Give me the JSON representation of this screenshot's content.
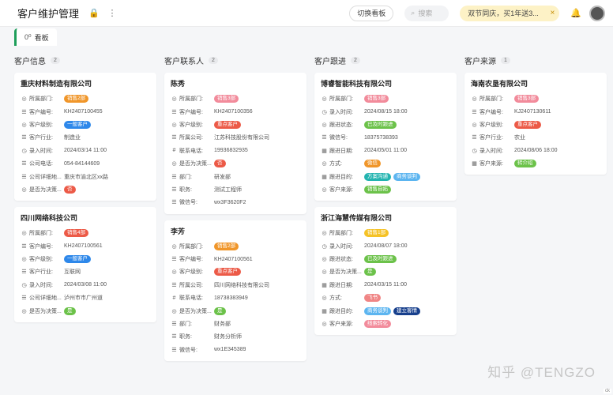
{
  "header": {
    "title": "客户维护管理",
    "switch_label": "切换看板",
    "search_placeholder": "搜索",
    "promo_text": "双节同庆，买1年送3...",
    "close_glyph": "×",
    "lock_glyph": "🔒",
    "more_glyph": "⋮",
    "bell_glyph": "🔔"
  },
  "tabs": [
    {
      "label": "看板",
      "prefix": "0⁰"
    }
  ],
  "colors": {
    "orange": "#f0962a",
    "blue": "#2e88ea",
    "red": "#ec5a47",
    "pink": "#f28b9b",
    "green": "#6cc24a",
    "yellow": "#f5c226",
    "teal": "#23b4b0",
    "navy": "#173f8c",
    "cyan": "#5cb5f0",
    "rose": "#f08585"
  },
  "columns": [
    {
      "title": "客户信息",
      "count": "2",
      "cards": [
        {
          "title": "重庆材料制造有限公司",
          "fields": [
            {
              "icon": "◎",
              "label": "所属部门:",
              "tags": [
                {
                  "text": "销售2部",
                  "color": "#f0962a"
                }
              ]
            },
            {
              "icon": "☰",
              "label": "客户编号:",
              "value": "KH2407100455"
            },
            {
              "icon": "◎",
              "label": "客户级别:",
              "tags": [
                {
                  "text": "一般客户",
                  "color": "#2e88ea"
                }
              ]
            },
            {
              "icon": "☰",
              "label": "客户行业:",
              "value": "制造业"
            },
            {
              "icon": "◷",
              "label": "录入时间:",
              "value": "2024/03/14 11:00"
            },
            {
              "icon": "☰",
              "label": "公司电话:",
              "value": "054-84144609"
            },
            {
              "icon": "☰",
              "label": "公司详细地...",
              "value": "重庆市渝北区xx路"
            },
            {
              "icon": "◎",
              "label": "是否为决策...",
              "tags": [
                {
                  "text": "否",
                  "color": "#ec5a47"
                }
              ]
            }
          ]
        },
        {
          "title": "四川网络科技公司",
          "fields": [
            {
              "icon": "◎",
              "label": "所属部门:",
              "tags": [
                {
                  "text": "销售4部",
                  "color": "#ec5a47"
                }
              ]
            },
            {
              "icon": "☰",
              "label": "客户编号:",
              "value": "KH2407100561"
            },
            {
              "icon": "◎",
              "label": "客户级别:",
              "tags": [
                {
                  "text": "一般客户",
                  "color": "#2e88ea"
                }
              ]
            },
            {
              "icon": "☰",
              "label": "客户行业:",
              "value": "互联网"
            },
            {
              "icon": "◷",
              "label": "录入时间:",
              "value": "2024/03/08 11:00"
            },
            {
              "icon": "☰",
              "label": "公司详细地...",
              "value": "泸州市市广州道"
            },
            {
              "icon": "◎",
              "label": "是否为决策...",
              "tags": [
                {
                  "text": "是",
                  "color": "#6cc24a"
                }
              ]
            }
          ]
        }
      ]
    },
    {
      "title": "客户联系人",
      "count": "2",
      "cards": [
        {
          "title": "陈秀",
          "fields": [
            {
              "icon": "◎",
              "label": "所属部门:",
              "tags": [
                {
                  "text": "销售3部",
                  "color": "#f28b9b"
                }
              ]
            },
            {
              "icon": "☰",
              "label": "客户编号:",
              "value": "KH2407100356"
            },
            {
              "icon": "◎",
              "label": "客户级别:",
              "tags": [
                {
                  "text": "重点客户",
                  "color": "#ec5a47"
                }
              ]
            },
            {
              "icon": "☰",
              "label": "所属公司:",
              "value": "江苏科技股份有限公司"
            },
            {
              "icon": "#",
              "label": "联系电话:",
              "value": "19936832935"
            },
            {
              "icon": "◎",
              "label": "是否为决策...",
              "tags": [
                {
                  "text": "否",
                  "color": "#ec5a47"
                }
              ]
            },
            {
              "icon": "☰",
              "label": "部门:",
              "value": "研发部"
            },
            {
              "icon": "☰",
              "label": "职务:",
              "value": "测试工程师"
            },
            {
              "icon": "☰",
              "label": "微信号:",
              "value": "wx3F3620F2"
            }
          ]
        },
        {
          "title": "李芳",
          "fields": [
            {
              "icon": "◎",
              "label": "所属部门:",
              "tags": [
                {
                  "text": "销售2部",
                  "color": "#f0962a"
                }
              ]
            },
            {
              "icon": "☰",
              "label": "客户编号:",
              "value": "KH2407100561"
            },
            {
              "icon": "◎",
              "label": "客户级别:",
              "tags": [
                {
                  "text": "重点客户",
                  "color": "#ec5a47"
                }
              ]
            },
            {
              "icon": "☰",
              "label": "所属公司:",
              "value": "四川网络科技有限公司"
            },
            {
              "icon": "#",
              "label": "联系电话:",
              "value": "18738383949"
            },
            {
              "icon": "◎",
              "label": "是否为决策...",
              "tags": [
                {
                  "text": "是",
                  "color": "#6cc24a"
                }
              ]
            },
            {
              "icon": "☰",
              "label": "部门:",
              "value": "财务部"
            },
            {
              "icon": "☰",
              "label": "职务:",
              "value": "财务分析师"
            },
            {
              "icon": "☰",
              "label": "微信号:",
              "value": "wx1E345389"
            }
          ]
        }
      ]
    },
    {
      "title": "客户跟进",
      "count": "2",
      "cards": [
        {
          "title": "博睿智能科技有限公司",
          "fields": [
            {
              "icon": "◎",
              "label": "所属部门:",
              "tags": [
                {
                  "text": "销售3部",
                  "color": "#f28b9b"
                }
              ]
            },
            {
              "icon": "◷",
              "label": "录入时间:",
              "value": "2024/08/15 18:00"
            },
            {
              "icon": "◎",
              "label": "跟进状态:",
              "tags": [
                {
                  "text": "已及时跟进",
                  "color": "#6cc24a"
                }
              ]
            },
            {
              "icon": "☰",
              "label": "微信号:",
              "value": "18375738393"
            },
            {
              "icon": "▦",
              "label": "跟进日期:",
              "value": "2024/05/01 11:00"
            },
            {
              "icon": "◎",
              "label": "方式:",
              "tags": [
                {
                  "text": "微信",
                  "color": "#f0962a"
                }
              ]
            },
            {
              "icon": "▦",
              "label": "跟进目的:",
              "tags": [
                {
                  "text": "方案沟通",
                  "color": "#23b4b0"
                },
                {
                  "text": "商务谈判",
                  "color": "#5cb5f0"
                }
              ]
            },
            {
              "icon": "◎",
              "label": "客户来源:",
              "tags": [
                {
                  "text": "销售自拓",
                  "color": "#6cc24a"
                }
              ]
            }
          ]
        },
        {
          "title": "浙江海慧传媒有限公司",
          "fields": [
            {
              "icon": "◎",
              "label": "所属部门:",
              "tags": [
                {
                  "text": "销售1部",
                  "color": "#f5c226"
                }
              ]
            },
            {
              "icon": "◷",
              "label": "录入时间:",
              "value": "2024/08/07 18:00"
            },
            {
              "icon": "◎",
              "label": "跟进状态:",
              "tags": [
                {
                  "text": "已及时跟进",
                  "color": "#6cc24a"
                }
              ]
            },
            {
              "icon": "◎",
              "label": "是否为决策...",
              "tags": [
                {
                  "text": "是",
                  "color": "#6cc24a"
                }
              ]
            },
            {
              "icon": "▦",
              "label": "跟进日期:",
              "value": "2024/03/15 11:00"
            },
            {
              "icon": "◎",
              "label": "方式:",
              "tags": [
                {
                  "text": "飞书",
                  "color": "#f08585"
                }
              ]
            },
            {
              "icon": "▦",
              "label": "跟进目的:",
              "tags": [
                {
                  "text": "商务谈判",
                  "color": "#5cb5f0"
                },
                {
                  "text": "建立客情",
                  "color": "#173f8c"
                }
              ]
            },
            {
              "icon": "◎",
              "label": "客户来源:",
              "tags": [
                {
                  "text": "线索转化",
                  "color": "#f28b9b"
                }
              ]
            }
          ]
        }
      ]
    },
    {
      "title": "客户来源",
      "count": "1",
      "cards": [
        {
          "title": "海南农垦有限公司",
          "fields": [
            {
              "icon": "◎",
              "label": "所属部门:",
              "tags": [
                {
                  "text": "销售3部",
                  "color": "#f28b9b"
                }
              ]
            },
            {
              "icon": "☰",
              "label": "客户编号:",
              "value": "KJ2407130611"
            },
            {
              "icon": "◎",
              "label": "客户级别:",
              "tags": [
                {
                  "text": "重点客户",
                  "color": "#ec5a47"
                }
              ]
            },
            {
              "icon": "☰",
              "label": "客户行业:",
              "value": "农业"
            },
            {
              "icon": "◷",
              "label": "录入时间:",
              "value": "2024/08/06 18:00"
            },
            {
              "icon": "▦",
              "label": "客户来源:",
              "tags": [
                {
                  "text": "转介绍",
                  "color": "#6cc24a"
                }
              ]
            }
          ]
        }
      ]
    }
  ],
  "watermark": "知乎 @TENGZO",
  "corner_label": "ck"
}
